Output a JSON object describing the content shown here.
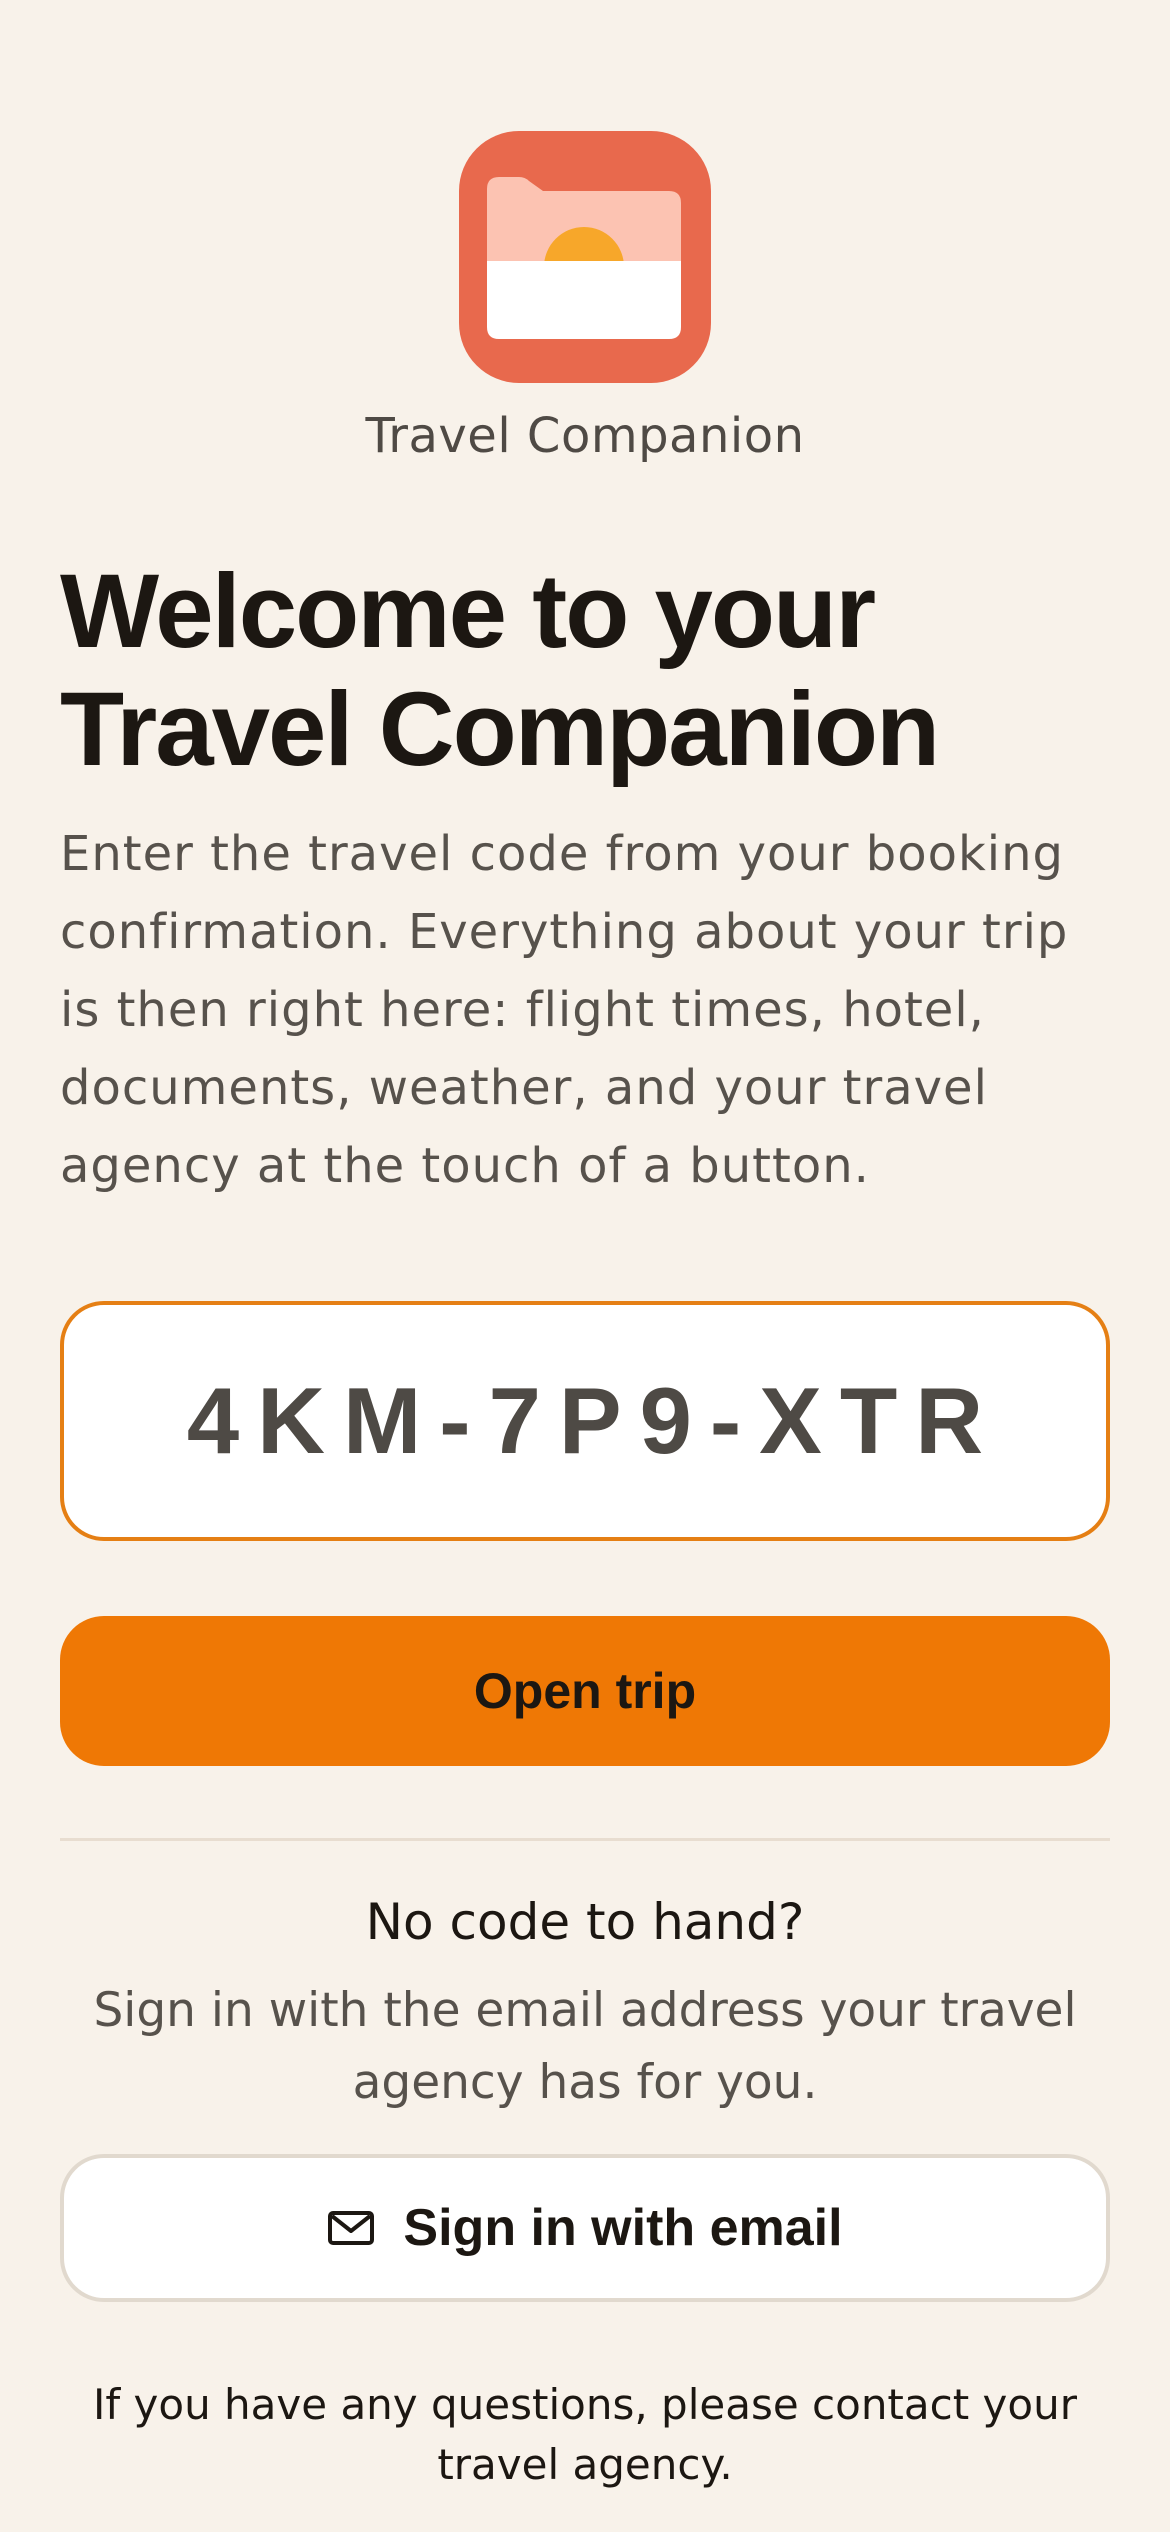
{
  "header": {
    "app_icon": "folder-sunrise-icon",
    "app_name": "Travel Companion"
  },
  "main": {
    "headline": "Welcome to your Travel Companion",
    "intro": "Enter the travel code from your booking confirmation. Everything about your trip is then right here: flight times, hotel, documents, weather, and your travel agency at the touch of a button.",
    "code_input": {
      "value": "4KM-7P9-XTR"
    },
    "open_trip_label": "Open trip"
  },
  "alternative": {
    "title": "No code to hand?",
    "description": "Sign in with the email address your travel agency has for you.",
    "email_button_icon": "mail-icon",
    "email_button_label": "Sign in with email"
  },
  "footer": {
    "note": "If you have any questions, please contact your travel agency."
  },
  "colors": {
    "background": "#f8f2ea",
    "accent": "#ef7805",
    "icon_tile": "#e8694d",
    "input_border": "#e57f14"
  }
}
